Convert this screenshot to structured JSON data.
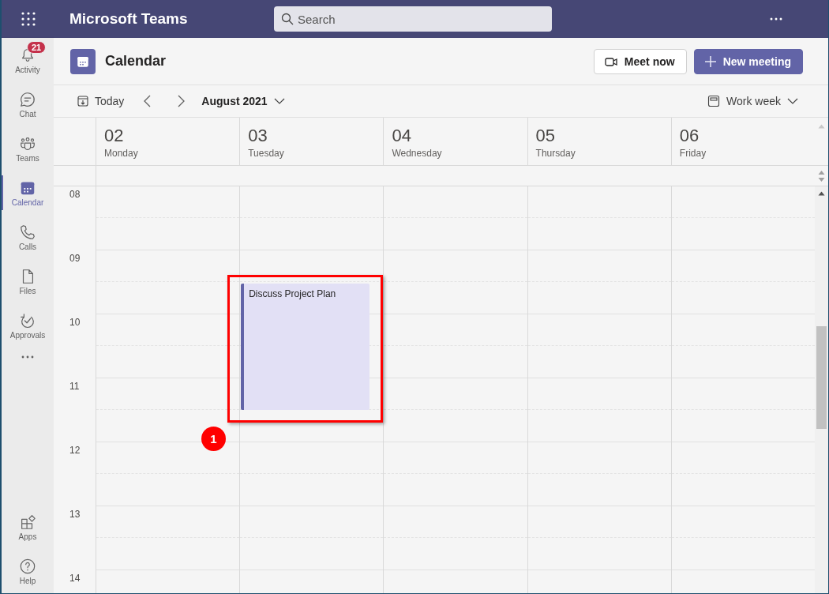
{
  "app_bar": {
    "title": "Microsoft Teams",
    "search": {
      "placeholder": "Search"
    }
  },
  "rail": {
    "items": [
      {
        "label": "Activity",
        "badge": "21",
        "selected": false
      },
      {
        "label": "Chat",
        "selected": false
      },
      {
        "label": "Teams",
        "selected": false
      },
      {
        "label": "Calendar",
        "selected": true
      },
      {
        "label": "Calls",
        "selected": false
      },
      {
        "label": "Files",
        "selected": false
      },
      {
        "label": "Approvals",
        "selected": false
      }
    ],
    "bottom_items": [
      {
        "label": "Apps",
        "selected": false
      },
      {
        "label": "Help",
        "selected": false
      }
    ]
  },
  "header": {
    "title": "Calendar",
    "buttons": [
      {
        "label": "Meet now",
        "kind": "secondary"
      },
      {
        "label": "New meeting",
        "kind": "primary"
      }
    ]
  },
  "toolbar": {
    "today": "Today",
    "month": "August 2021",
    "view": "Work week"
  },
  "days": [
    {
      "date": "02",
      "weekday": "Monday"
    },
    {
      "date": "03",
      "weekday": "Tuesday",
      "events": [
        {
          "title": "Discuss Project Plan"
        }
      ]
    },
    {
      "date": "04",
      "weekday": "Wednesday"
    },
    {
      "date": "05",
      "weekday": "Thursday"
    },
    {
      "date": "06",
      "weekday": "Friday"
    }
  ],
  "hours": [
    "08",
    "09",
    "10",
    "11",
    "12",
    "13",
    "14"
  ],
  "annotation": {
    "label": "1"
  }
}
